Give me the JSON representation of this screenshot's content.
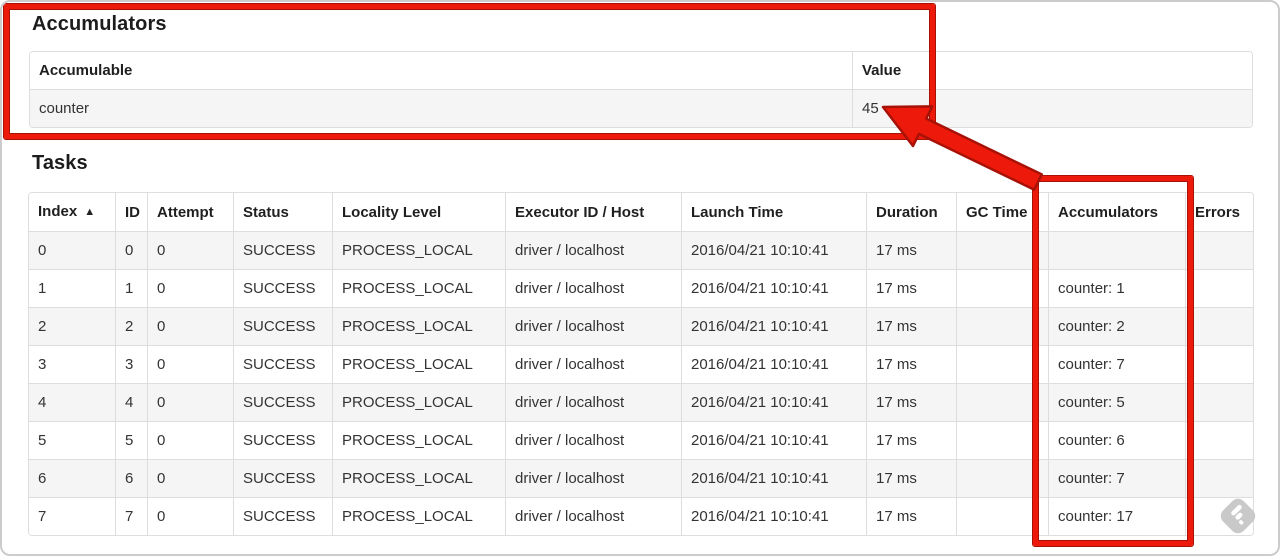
{
  "accumulators_section": {
    "title": "Accumulators",
    "table": {
      "headers": [
        "Accumulable",
        "Value"
      ],
      "rows": [
        {
          "name": "counter",
          "value": "45"
        }
      ]
    }
  },
  "tasks_section": {
    "title": "Tasks",
    "table": {
      "headers": [
        "Index",
        "ID",
        "Attempt",
        "Status",
        "Locality Level",
        "Executor ID / Host",
        "Launch Time",
        "Duration",
        "GC Time",
        "Accumulators",
        "Errors"
      ],
      "sort": {
        "column": "Index",
        "direction": "ascending",
        "icon": "▲"
      },
      "rows": [
        {
          "index": "0",
          "id": "0",
          "attempt": "0",
          "status": "SUCCESS",
          "locality_level": "PROCESS_LOCAL",
          "executor_id_host": "driver / localhost",
          "launch_time": "2016/04/21 10:10:41",
          "duration": "17 ms",
          "gc_time": "",
          "accumulators": "",
          "errors": ""
        },
        {
          "index": "1",
          "id": "1",
          "attempt": "0",
          "status": "SUCCESS",
          "locality_level": "PROCESS_LOCAL",
          "executor_id_host": "driver / localhost",
          "launch_time": "2016/04/21 10:10:41",
          "duration": "17 ms",
          "gc_time": "",
          "accumulators": "counter: 1",
          "errors": ""
        },
        {
          "index": "2",
          "id": "2",
          "attempt": "0",
          "status": "SUCCESS",
          "locality_level": "PROCESS_LOCAL",
          "executor_id_host": "driver / localhost",
          "launch_time": "2016/04/21 10:10:41",
          "duration": "17 ms",
          "gc_time": "",
          "accumulators": "counter: 2",
          "errors": ""
        },
        {
          "index": "3",
          "id": "3",
          "attempt": "0",
          "status": "SUCCESS",
          "locality_level": "PROCESS_LOCAL",
          "executor_id_host": "driver / localhost",
          "launch_time": "2016/04/21 10:10:41",
          "duration": "17 ms",
          "gc_time": "",
          "accumulators": "counter: 7",
          "errors": ""
        },
        {
          "index": "4",
          "id": "4",
          "attempt": "0",
          "status": "SUCCESS",
          "locality_level": "PROCESS_LOCAL",
          "executor_id_host": "driver / localhost",
          "launch_time": "2016/04/21 10:10:41",
          "duration": "17 ms",
          "gc_time": "",
          "accumulators": "counter: 5",
          "errors": ""
        },
        {
          "index": "5",
          "id": "5",
          "attempt": "0",
          "status": "SUCCESS",
          "locality_level": "PROCESS_LOCAL",
          "executor_id_host": "driver / localhost",
          "launch_time": "2016/04/21 10:10:41",
          "duration": "17 ms",
          "gc_time": "",
          "accumulators": "counter: 6",
          "errors": ""
        },
        {
          "index": "6",
          "id": "6",
          "attempt": "0",
          "status": "SUCCESS",
          "locality_level": "PROCESS_LOCAL",
          "executor_id_host": "driver / localhost",
          "launch_time": "2016/04/21 10:10:41",
          "duration": "17 ms",
          "gc_time": "",
          "accumulators": "counter: 7",
          "errors": ""
        },
        {
          "index": "7",
          "id": "7",
          "attempt": "0",
          "status": "SUCCESS",
          "locality_level": "PROCESS_LOCAL",
          "executor_id_host": "driver / localhost",
          "launch_time": "2016/04/21 10:10:41",
          "duration": "17 ms",
          "gc_time": "",
          "accumulators": "counter: 17",
          "errors": ""
        }
      ]
    }
  },
  "annotations": {
    "highlight_color": "#ed1a0b",
    "highlight_outline_color": "#a81106"
  },
  "watermark": {
    "icon": "feedly-logo",
    "color": "#c9c9c9"
  }
}
